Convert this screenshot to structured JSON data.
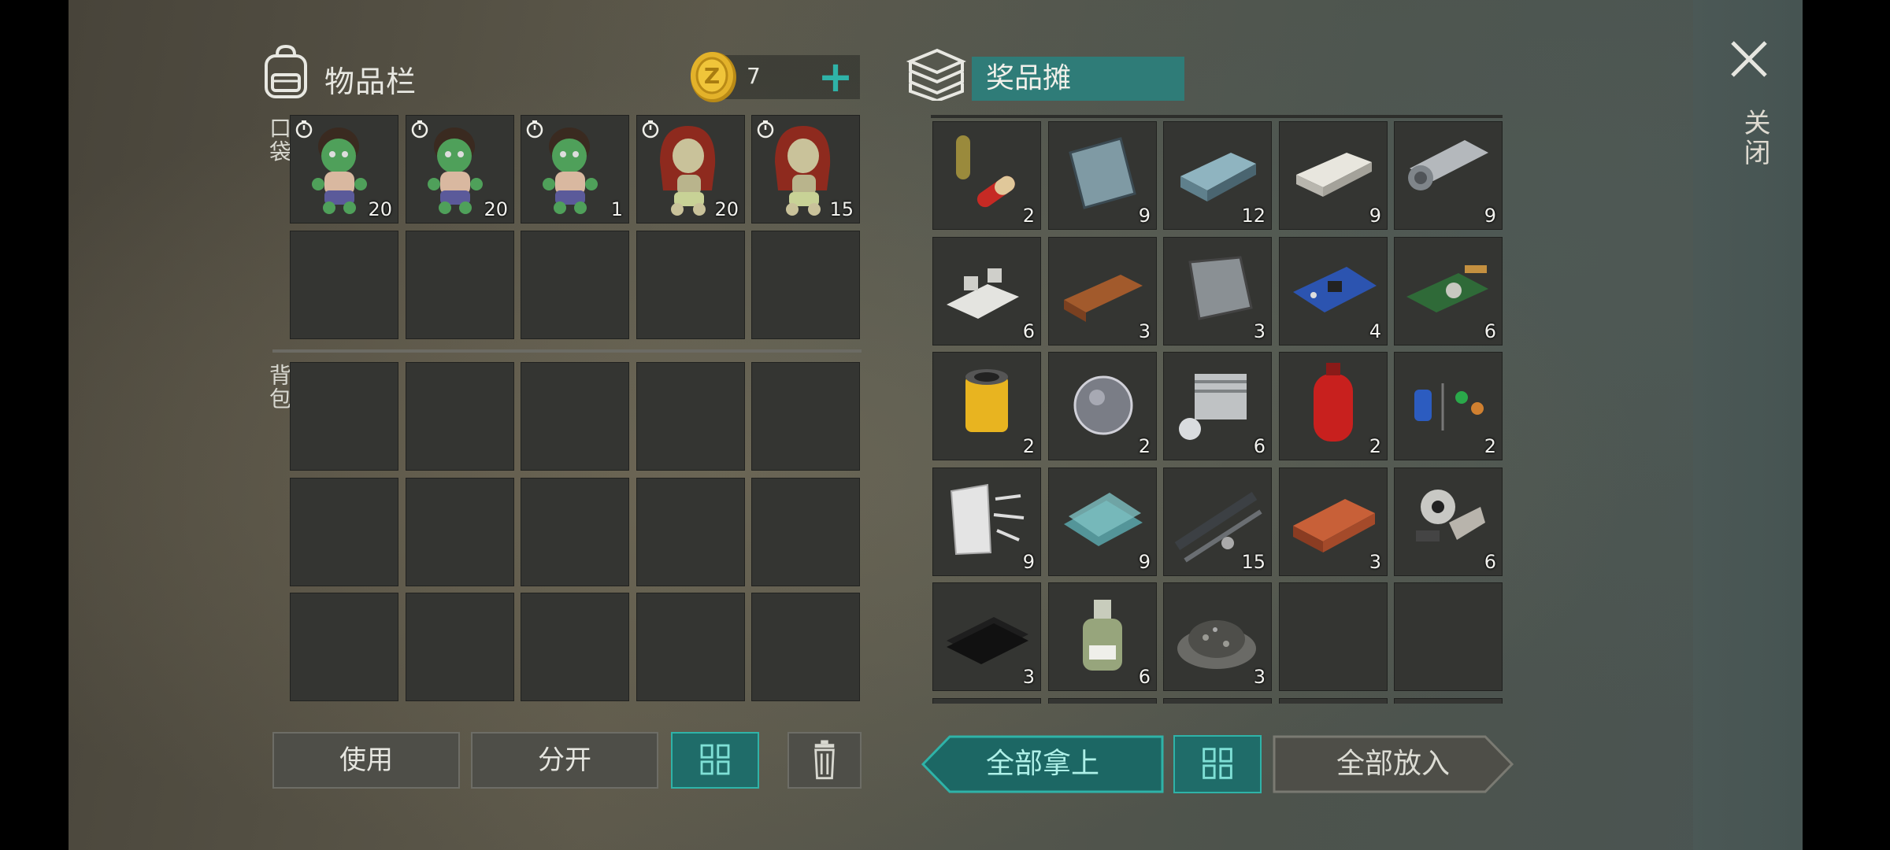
{
  "inventory": {
    "title": "物品栏",
    "pocket_label": "口袋",
    "backpack_label": "背包",
    "coins": "7",
    "coin_plus": "+",
    "pocket_items": [
      {
        "icon": "zombie-doll-icon",
        "count": "20"
      },
      {
        "icon": "zombie-doll-icon",
        "count": "20"
      },
      {
        "icon": "zombie-doll-icon",
        "count": "1"
      },
      {
        "icon": "red-hair-doll-icon",
        "count": "20"
      },
      {
        "icon": "red-hair-doll-icon",
        "count": "15"
      }
    ]
  },
  "stash": {
    "title": "奖品摊",
    "items": [
      {
        "icon": "pills-icon",
        "count": "2"
      },
      {
        "icon": "steel-plate-icon",
        "count": "9"
      },
      {
        "icon": "iron-ingot-icon",
        "count": "12"
      },
      {
        "icon": "silver-ingot-icon",
        "count": "9"
      },
      {
        "icon": "metal-roll-icon",
        "count": "9"
      },
      {
        "icon": "aluminium-bars-icon",
        "count": "6"
      },
      {
        "icon": "wood-plank-icon",
        "count": "3"
      },
      {
        "icon": "metal-sheet-icon",
        "count": "3"
      },
      {
        "icon": "circuit-board-icon",
        "count": "4"
      },
      {
        "icon": "sensor-board-icon",
        "count": "6"
      },
      {
        "icon": "air-filter-icon",
        "count": "2"
      },
      {
        "icon": "lens-icon",
        "count": "2"
      },
      {
        "icon": "engine-cylinder-icon",
        "count": "6"
      },
      {
        "icon": "gas-cylinder-icon",
        "count": "2"
      },
      {
        "icon": "electronic-components-icon",
        "count": "2"
      },
      {
        "icon": "fiberglass-icon",
        "count": "9"
      },
      {
        "icon": "glass-panes-icon",
        "count": "9"
      },
      {
        "icon": "metal-pipe-icon",
        "count": "15"
      },
      {
        "icon": "brick-icon",
        "count": "3"
      },
      {
        "icon": "mechanical-parts-icon",
        "count": "6"
      },
      {
        "icon": "rubber-sheet-icon",
        "count": "3"
      },
      {
        "icon": "chemical-bottle-icon",
        "count": "6"
      },
      {
        "icon": "gravel-icon",
        "count": "3"
      },
      {
        "icon": "",
        "count": ""
      },
      {
        "icon": "",
        "count": ""
      }
    ]
  },
  "buttons": {
    "use": "使用",
    "split": "分开",
    "take_all": "全部拿上",
    "put_all": "全部放入"
  },
  "close": {
    "label": "关闭"
  },
  "colors": {
    "accent": "#2fb3a8",
    "accent_dark": "#1f6c69",
    "slot": "#343532"
  }
}
